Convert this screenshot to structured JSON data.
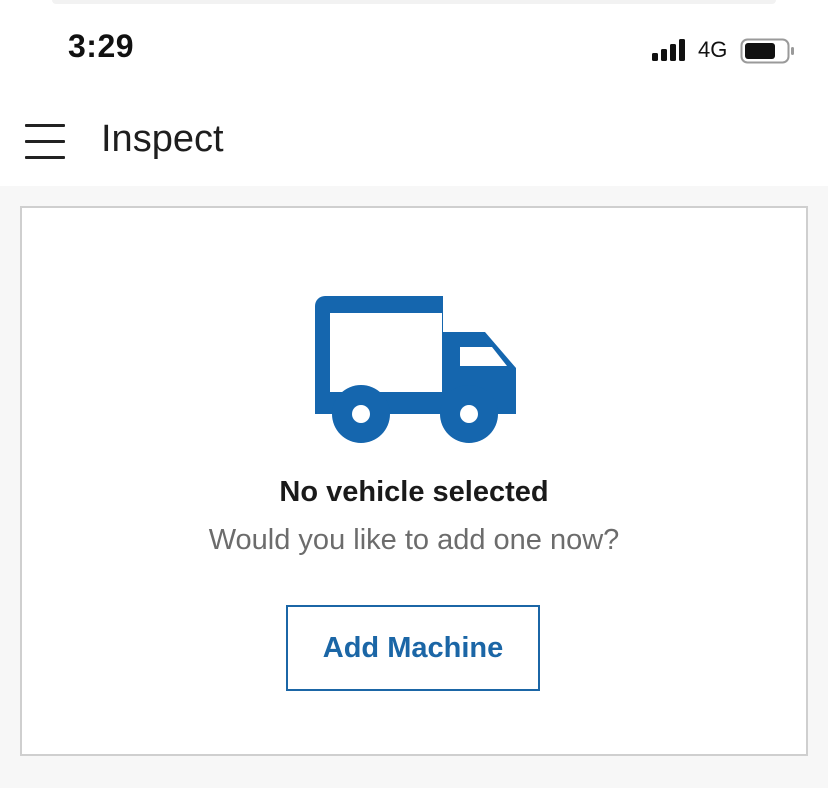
{
  "status_bar": {
    "time": "3:29",
    "network": "4G",
    "signal_icon": "cellular-signal-icon",
    "battery_icon": "battery-icon"
  },
  "header": {
    "menu_icon": "hamburger-menu-icon",
    "title": "Inspect"
  },
  "empty_state": {
    "icon": "truck-icon",
    "title": "No vehicle selected",
    "subtitle": "Would you like to add one now?",
    "button_label": "Add Machine"
  },
  "colors": {
    "accent": "#1b66a6",
    "icon": "#1566ae",
    "background": "#f7f7f7",
    "card_border": "#cfcfcf"
  }
}
